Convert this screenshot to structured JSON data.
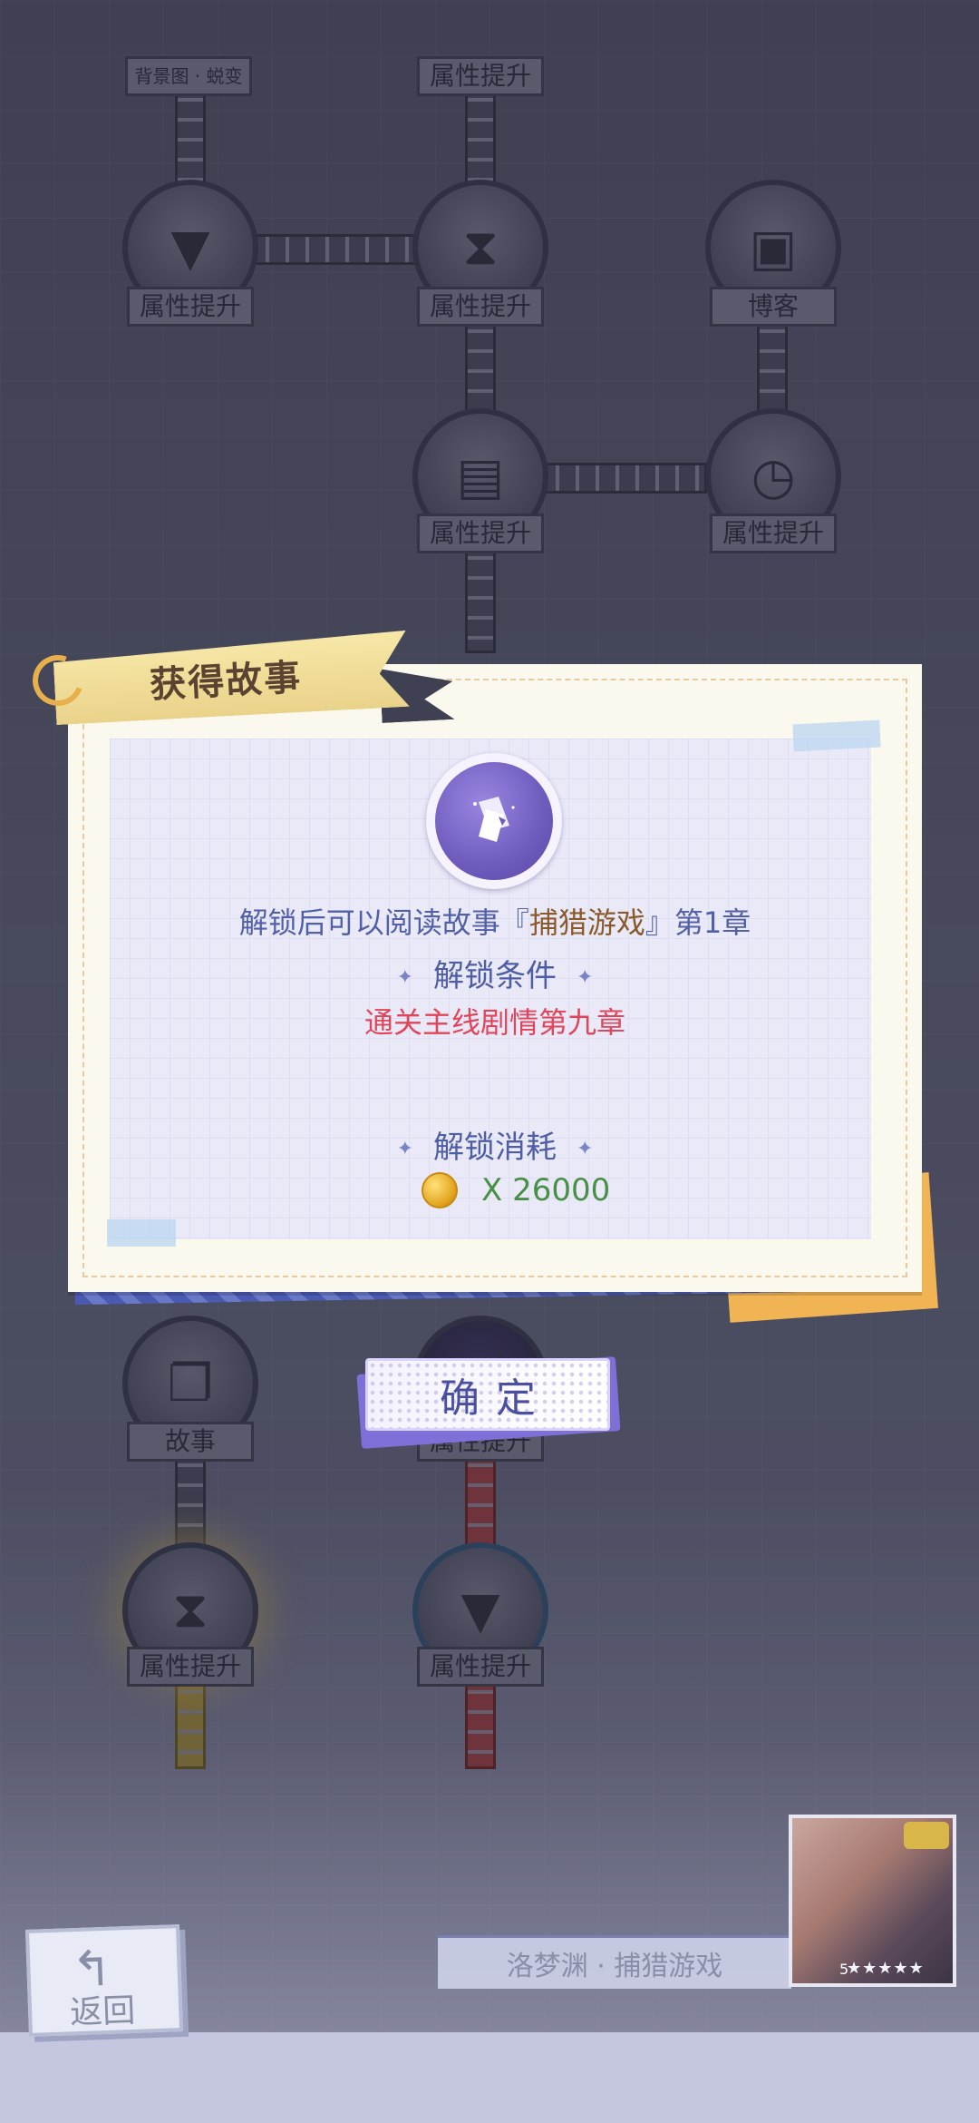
{
  "tree": {
    "nodes": [
      {
        "id": "bg-transform",
        "label": "背景图 · 蜕变"
      },
      {
        "id": "attr-top",
        "label": "属性提升"
      },
      {
        "id": "attr-fan-1",
        "label": "属性提升"
      },
      {
        "id": "attr-hourglass-1",
        "label": "属性提升"
      },
      {
        "id": "blog",
        "label": "博客"
      },
      {
        "id": "attr-news",
        "label": "属性提升"
      },
      {
        "id": "attr-clock",
        "label": "属性提升"
      },
      {
        "id": "story-lower",
        "label": "故事"
      },
      {
        "id": "attr-mid-hidden",
        "label": "属性提升"
      },
      {
        "id": "attr-hourglass-2",
        "label": "属性提升"
      },
      {
        "id": "attr-fan-2",
        "label": "属性提升"
      }
    ]
  },
  "dialog": {
    "title": "获得故事",
    "unlock_prefix": "解锁后可以阅读故事『",
    "story_name": "捕猎游戏",
    "unlock_suffix": "』第1章",
    "condition_title": "解锁条件",
    "condition_text": "通关主线剧情第九章",
    "cost_title": "解锁消耗",
    "cost_value": "X 26000",
    "confirm_label": "确定",
    "colors": {
      "accent": "#5160a8",
      "condition": "#e0455a",
      "cost": "#4a8f48"
    }
  },
  "footer": {
    "back_label": "返回",
    "story_label": "洛梦渊 · 捕猎游戏",
    "card_level": "5",
    "card_stars": "★★★★★"
  }
}
